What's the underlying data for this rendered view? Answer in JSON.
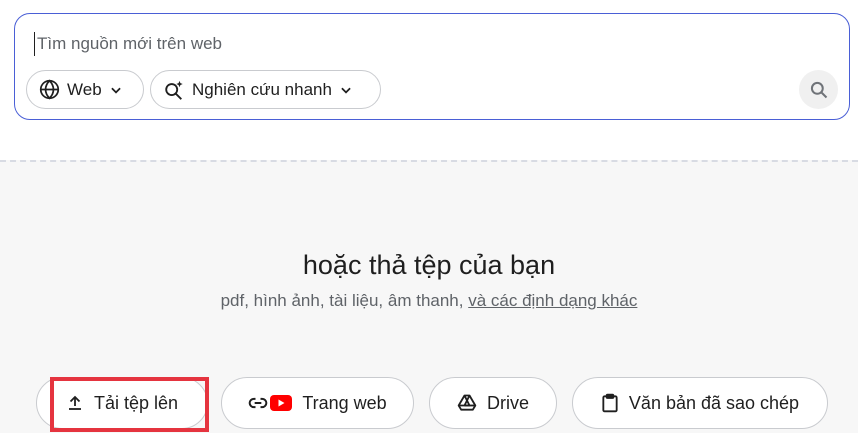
{
  "search": {
    "placeholder": "Tìm nguồn mới trên web",
    "source_chip": {
      "label": "Web",
      "icon": "globe-icon"
    },
    "mode_chip": {
      "label": "Nghiên cứu nhanh",
      "icon": "sparkle-search-icon"
    },
    "submit_icon": "search-icon"
  },
  "drop": {
    "title": "hoặc thả tệp của bạn",
    "subtitle_prefix": "pdf, hình ảnh, tài liệu, âm thanh, ",
    "formats_link": "và các định dạng khác"
  },
  "actions": [
    {
      "label": "Tải tệp lên",
      "icon": "upload-icon"
    },
    {
      "label": "Trang web",
      "icon": "link-youtube-icon"
    },
    {
      "label": "Drive",
      "icon": "drive-icon"
    },
    {
      "label": "Văn bản đã sao chép",
      "icon": "clipboard-icon"
    }
  ],
  "colors": {
    "accent_border": "#4a5fd6",
    "highlight": "#e5343f",
    "youtube_red": "#ff0000",
    "background": "#f7f7f7"
  }
}
